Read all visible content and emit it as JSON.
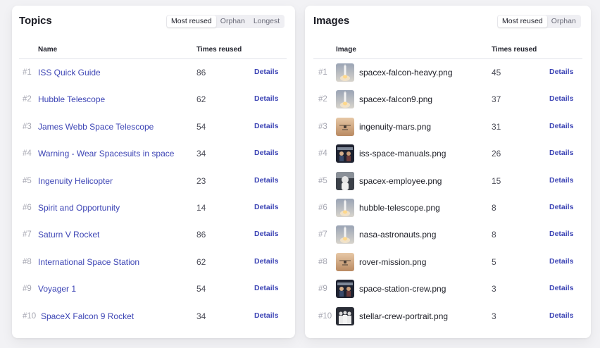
{
  "topics": {
    "title": "Topics",
    "filters": [
      {
        "label": "Most reused",
        "active": true
      },
      {
        "label": "Orphan",
        "active": false
      },
      {
        "label": "Longest",
        "active": false
      }
    ],
    "columns": {
      "name": "Name",
      "count": "Times reused"
    },
    "details_label": "Details",
    "rows": [
      {
        "rank": "#1",
        "name": "ISS Quick Guide",
        "count": "86"
      },
      {
        "rank": "#2",
        "name": "Hubble Telescope",
        "count": "62"
      },
      {
        "rank": "#3",
        "name": "James Webb Space Telescope",
        "count": "54"
      },
      {
        "rank": "#4",
        "name": "Warning - Wear Spacesuits in space",
        "count": "34"
      },
      {
        "rank": "#5",
        "name": "Ingenuity Helicopter",
        "count": "23"
      },
      {
        "rank": "#6",
        "name": "Spirit and Opportunity",
        "count": "14"
      },
      {
        "rank": "#7",
        "name": "Saturn V Rocket",
        "count": "86"
      },
      {
        "rank": "#8",
        "name": "International Space Station",
        "count": "62"
      },
      {
        "rank": "#9",
        "name": "Voyager 1",
        "count": "54"
      },
      {
        "rank": "#10",
        "name": "SpaceX Falcon 9 Rocket",
        "count": "34"
      }
    ]
  },
  "images": {
    "title": "Images",
    "filters": [
      {
        "label": "Most reused",
        "active": true
      },
      {
        "label": "Orphan",
        "active": false
      }
    ],
    "columns": {
      "name": "Image",
      "count": "Times reused"
    },
    "details_label": "Details",
    "rows": [
      {
        "rank": "#1",
        "name": "spacex-falcon-heavy.png",
        "count": "45",
        "thumb": "rocket"
      },
      {
        "rank": "#2",
        "name": "spacex-falcon9.png",
        "count": "37",
        "thumb": "rocket"
      },
      {
        "rank": "#3",
        "name": "ingenuity-mars.png",
        "count": "31",
        "thumb": "mars"
      },
      {
        "rank": "#4",
        "name": "iss-space-manuals.png",
        "count": "26",
        "thumb": "crew"
      },
      {
        "rank": "#5",
        "name": "spacex-employee.png",
        "count": "15",
        "thumb": "portrait"
      },
      {
        "rank": "#6",
        "name": "hubble-telescope.png",
        "count": "8",
        "thumb": "rocket"
      },
      {
        "rank": "#7",
        "name": "nasa-astronauts.png",
        "count": "8",
        "thumb": "rocket"
      },
      {
        "rank": "#8",
        "name": "rover-mission.png",
        "count": "5",
        "thumb": "mars"
      },
      {
        "rank": "#9",
        "name": "space-station-crew.png",
        "count": "3",
        "thumb": "crew"
      },
      {
        "rank": "#10",
        "name": "stellar-crew-portrait.png",
        "count": "3",
        "thumb": "group"
      }
    ]
  }
}
